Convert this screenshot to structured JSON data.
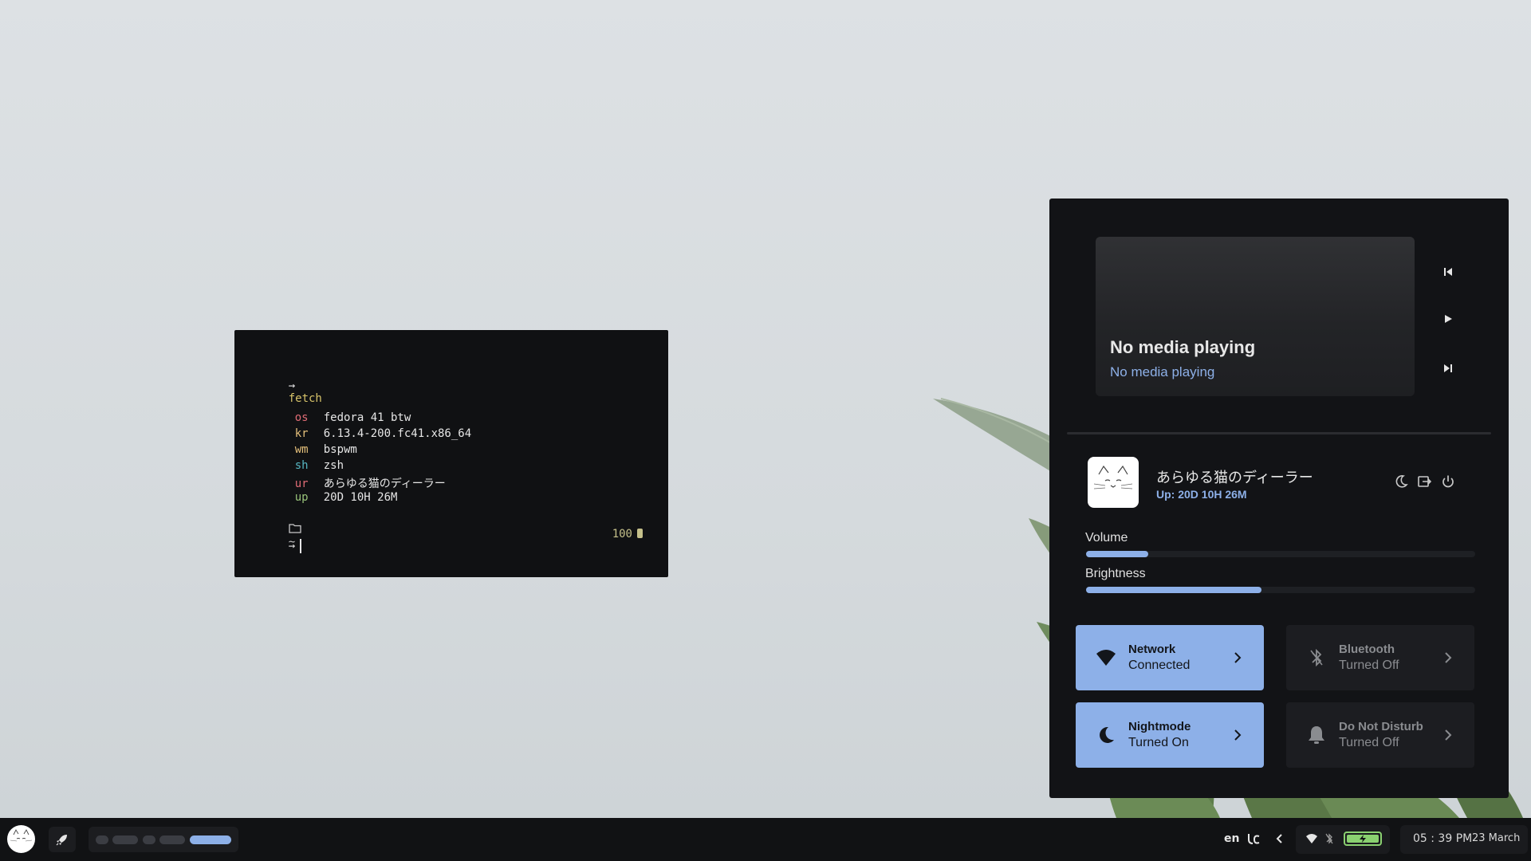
{
  "terminal": {
    "prompt_symbol": "→",
    "command": "fetch",
    "info": [
      {
        "key": "os",
        "value": "fedora 41 btw"
      },
      {
        "key": "kr",
        "value": "6.13.4-200.fc41.x86_64"
      },
      {
        "key": "wm",
        "value": "bspwm"
      },
      {
        "key": "sh",
        "value": "zsh"
      },
      {
        "key": "ur",
        "value": "あらゆる猫のディーラー"
      },
      {
        "key": "up",
        "value": "20D 10H 26M"
      }
    ],
    "cwd": "~",
    "battery": "100"
  },
  "control_center": {
    "media": {
      "title": "No media playing",
      "subtitle": "No media playing",
      "controls": [
        "previous-icon",
        "play-icon",
        "next-icon"
      ]
    },
    "user": {
      "name": "あらゆる猫のディーラー",
      "uptime": "Up: 20D 10H 26M",
      "actions": [
        "moon-icon",
        "logout-icon",
        "power-icon"
      ]
    },
    "sliders": {
      "volume": {
        "label": "Volume",
        "value": 0.16
      },
      "brightness": {
        "label": "Brightness",
        "value": 0.45
      }
    },
    "tiles": {
      "network": {
        "title": "Network",
        "status": "Connected",
        "active": true
      },
      "bluetooth": {
        "title": "Bluetooth",
        "status": "Turned Off",
        "active": false
      },
      "nightmode": {
        "title": "Nightmode",
        "status": "Turned On",
        "active": true
      },
      "dnd": {
        "title": "Do Not Disturb",
        "status": "Turned Off",
        "active": false
      }
    }
  },
  "taskbar": {
    "language": "en",
    "time": "05 : 39 PM",
    "date": "23 March",
    "workspaces": [
      {
        "active": false
      },
      {
        "active": false
      },
      {
        "active": false
      },
      {
        "active": false
      },
      {
        "active": true
      }
    ]
  },
  "colors": {
    "accent": "#8db0e8",
    "panel": "#121316",
    "battery": "#8ad070"
  }
}
